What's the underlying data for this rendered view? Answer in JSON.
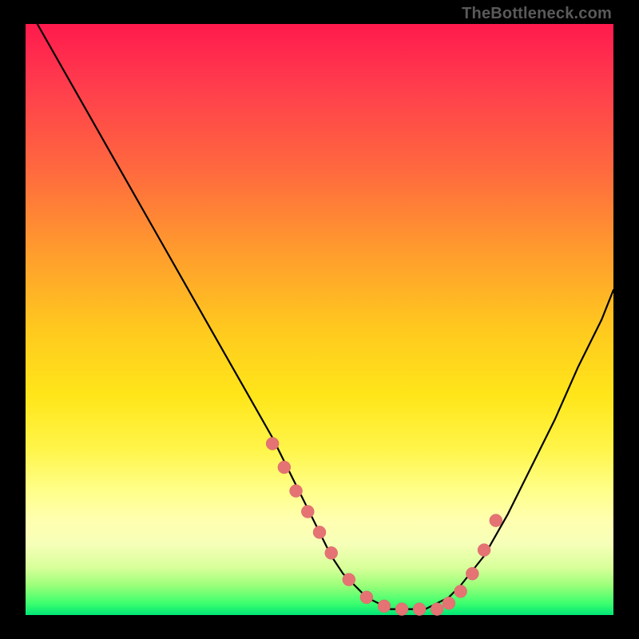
{
  "watermark": "TheBottleneck.com",
  "chart_data": {
    "type": "line",
    "title": "",
    "xlabel": "",
    "ylabel": "",
    "xlim": [
      0,
      100
    ],
    "ylim": [
      0,
      100
    ],
    "grid": false,
    "legend": false,
    "series": [
      {
        "name": "bottleneck-curve",
        "x": [
          2,
          6,
          10,
          14,
          18,
          22,
          26,
          30,
          34,
          38,
          42,
          44,
          46,
          48,
          50,
          52,
          54,
          56,
          58,
          60,
          62,
          64,
          66,
          68,
          70,
          72,
          74,
          78,
          82,
          86,
          90,
          94,
          98,
          100
        ],
        "y": [
          100,
          93,
          86,
          79,
          72,
          65,
          58,
          51,
          44,
          37,
          30,
          26,
          22,
          18,
          14,
          10,
          7,
          5,
          3,
          2,
          1,
          1,
          1,
          1,
          2,
          3,
          5,
          10,
          17,
          25,
          33,
          42,
          50,
          55
        ]
      },
      {
        "name": "highlighted-dots",
        "x": [
          42,
          44,
          46,
          48,
          50,
          52,
          55,
          58,
          61,
          64,
          67,
          70,
          72,
          74,
          76,
          78,
          80
        ],
        "y": [
          29,
          25,
          21,
          17.5,
          14,
          10.5,
          6,
          3,
          1.5,
          1,
          1,
          1,
          2,
          4,
          7,
          11,
          16
        ]
      }
    ],
    "annotations": [
      {
        "text": "TheBottleneck.com",
        "position": "top-right"
      }
    ]
  },
  "colors": {
    "background": "#000000",
    "gradient_top": "#ff1a4d",
    "gradient_mid": "#ffe61a",
    "gradient_bottom": "#00e676",
    "curve": "#000000",
    "dots": "#e57373",
    "watermark": "#5a5a5a"
  }
}
